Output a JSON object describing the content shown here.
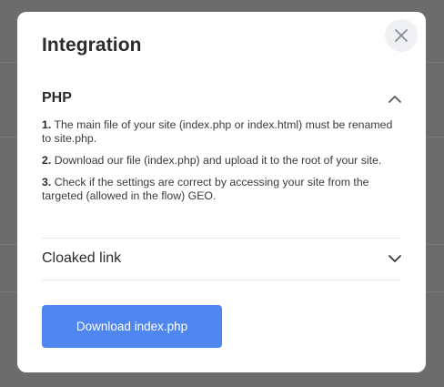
{
  "modal": {
    "title": "Integration",
    "close_icon": "close-icon"
  },
  "php_section": {
    "title": "PHP",
    "toggle_icon": "chevron-up-icon",
    "steps": [
      {
        "number": "1.",
        "text": "The main file of your site (index.php or index.html) must be renamed to site.php."
      },
      {
        "number": "2.",
        "text": "Download our file (index.php) and upload it to the root of your site."
      },
      {
        "number": "3.",
        "text": "Check if the settings are correct by accessing your site from the targeted (allowed in the flow) GEO."
      }
    ]
  },
  "cloaked_section": {
    "title": "Cloaked link",
    "toggle_icon": "chevron-down-icon"
  },
  "download_button": {
    "label": "Download index.php"
  },
  "colors": {
    "overlay": "#6c6c6c",
    "button": "#4f86f0",
    "close_bg": "#eef0f3"
  }
}
